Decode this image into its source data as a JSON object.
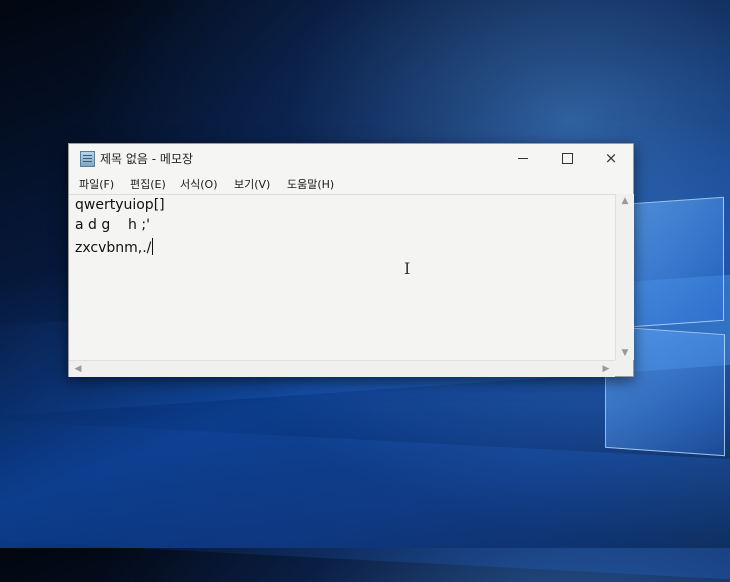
{
  "window": {
    "title": "제목 없음 - 메모장",
    "controls": {
      "minimize": "minimize",
      "maximize": "maximize",
      "close": "×"
    }
  },
  "menu": {
    "file": "파일(F)",
    "edit": "편집(E)",
    "format": "서식(O)",
    "view": "보기(V)",
    "help": "도움말(H)"
  },
  "editor": {
    "lines": [
      "qwertyuiop[]",
      "a d g    h ;'",
      "zxcvbnm,./"
    ]
  },
  "scrollbar": {
    "up": "▲",
    "down": "▼",
    "left": "◀",
    "right": "▶"
  },
  "icons": {
    "app": "notepad-icon",
    "cursor": "i-beam-cursor"
  }
}
